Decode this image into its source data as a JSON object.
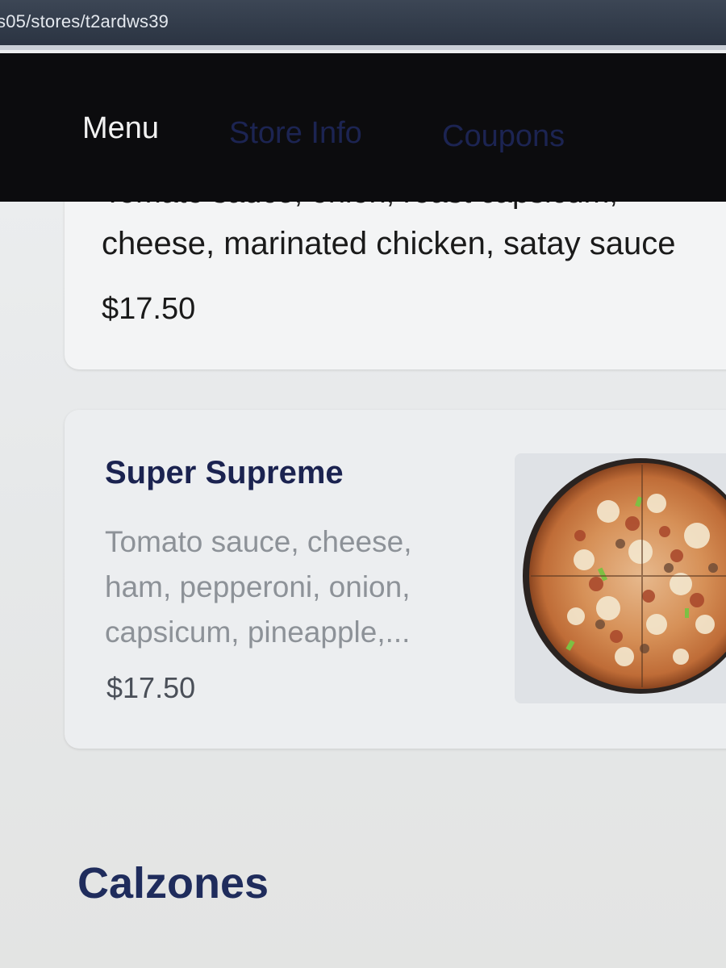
{
  "browser": {
    "url": "s05/stores/t2ardws39"
  },
  "nav": {
    "tabs": [
      {
        "label": "Menu",
        "active": true
      },
      {
        "label": "Store Info",
        "active": false
      },
      {
        "label": "Coupons",
        "active": false
      }
    ]
  },
  "items": [
    {
      "desc_cut": "Tomato sauce, onion, roast capsicum,",
      "desc_line2": "cheese, marinated chicken, satay sauce",
      "price": "$17.50"
    },
    {
      "name": "Super Supreme",
      "description": "Tomato sauce, cheese, ham, pepperoni, onion, capsicum, pineapple,...",
      "price": "$17.50",
      "image_icon": "pizza-image"
    }
  ],
  "section": {
    "title": "Calzones"
  },
  "colors": {
    "nav_bg": "#0c0c0e",
    "accent": "#1b2350",
    "inactive_tab": "#1c2452"
  }
}
